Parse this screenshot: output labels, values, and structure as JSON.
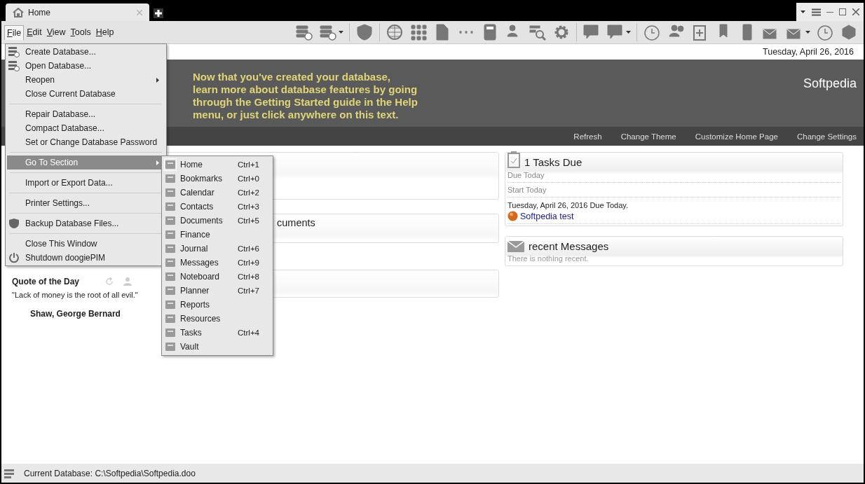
{
  "tabs": [
    {
      "label": "Home",
      "selected": true
    }
  ],
  "menu_bar": [
    {
      "label": "File",
      "selected": true
    },
    {
      "label": "Edit",
      "selected": false
    },
    {
      "label": "View",
      "selected": false
    },
    {
      "label": "Tools",
      "selected": false
    },
    {
      "label": "Help",
      "selected": false
    }
  ],
  "date": "Tuesday, April 26, 2016",
  "banner": {
    "message_lines": [
      "Now that you've created your database,",
      "learn more about database features by going",
      "through the Getting Started guide in the Help",
      "menu, or just click anywhere on this text."
    ],
    "user": "Softpedia"
  },
  "nav_links": [
    "Refresh",
    "Change Theme",
    "Customize Home Page",
    "Change Settings"
  ],
  "quote": {
    "title": "Quote of the Day",
    "text": "\"Lack of money is the root of all evil.\"",
    "author": "Shaw, George Bernard"
  },
  "middle_panel": {
    "title": "cuments"
  },
  "tasks_panel": {
    "title": "1 Tasks Due",
    "sections": [
      "Due Today",
      "Start Today"
    ],
    "due_line": "Tuesday, April 26, 2016 Due Today.",
    "task": "Softpedia test"
  },
  "messages_panel": {
    "title": "recent Messages",
    "empty": "There is nothing recent."
  },
  "status_bar": "Current Database: C:\\Softpedia\\Softpedia.doo",
  "file_menu": [
    [
      {
        "label": "Create Database...",
        "submenu": false,
        "selected": false
      },
      {
        "label": "Open Database...",
        "submenu": false,
        "selected": false
      },
      {
        "label": "Reopen",
        "submenu": true,
        "selected": false
      },
      {
        "label": "Close Current Database",
        "submenu": false,
        "selected": false
      }
    ],
    [
      {
        "label": "Repair Database...",
        "submenu": false,
        "selected": false
      },
      {
        "label": "Compact Database...",
        "submenu": false,
        "selected": false
      },
      {
        "label": "Set or Change Database Password",
        "submenu": false,
        "selected": false
      }
    ],
    [
      {
        "label": "Go To Section",
        "submenu": true,
        "selected": true
      }
    ],
    [
      {
        "label": "Import or Export Data...",
        "submenu": false,
        "selected": false
      }
    ],
    [
      {
        "label": "Printer Settings...",
        "submenu": false,
        "selected": false
      }
    ],
    [
      {
        "label": "Backup Database Files...",
        "submenu": false,
        "selected": false
      }
    ],
    [
      {
        "label": "Close This Window",
        "submenu": false,
        "selected": false
      },
      {
        "label": "Shutdown doogiePIM",
        "submenu": false,
        "selected": false
      }
    ]
  ],
  "section_menu": [
    {
      "label": "Home",
      "shortcut": "Ctrl+1",
      "selected": true
    },
    {
      "label": "Bookmarks",
      "shortcut": "Ctrl+0",
      "selected": false
    },
    {
      "label": "Calendar",
      "shortcut": "Ctrl+2",
      "selected": false
    },
    {
      "label": "Contacts",
      "shortcut": "Ctrl+3",
      "selected": false
    },
    {
      "label": "Documents",
      "shortcut": "Ctrl+5",
      "selected": false
    },
    {
      "label": "Finance",
      "selected": false
    },
    {
      "label": "Journal",
      "shortcut": "Ctrl+6",
      "selected": false
    },
    {
      "label": "Messages",
      "shortcut": "Ctrl+9",
      "selected": false
    },
    {
      "label": "Noteboard",
      "shortcut": "Ctrl+8",
      "selected": false
    },
    {
      "label": "Planner",
      "shortcut": "Ctrl+7",
      "selected": false
    },
    {
      "label": "Reports",
      "selected": false
    },
    {
      "label": "Resources",
      "selected": false
    },
    {
      "label": "Tasks",
      "shortcut": "Ctrl+4",
      "selected": false
    },
    {
      "label": "Vault",
      "selected": false
    }
  ]
}
